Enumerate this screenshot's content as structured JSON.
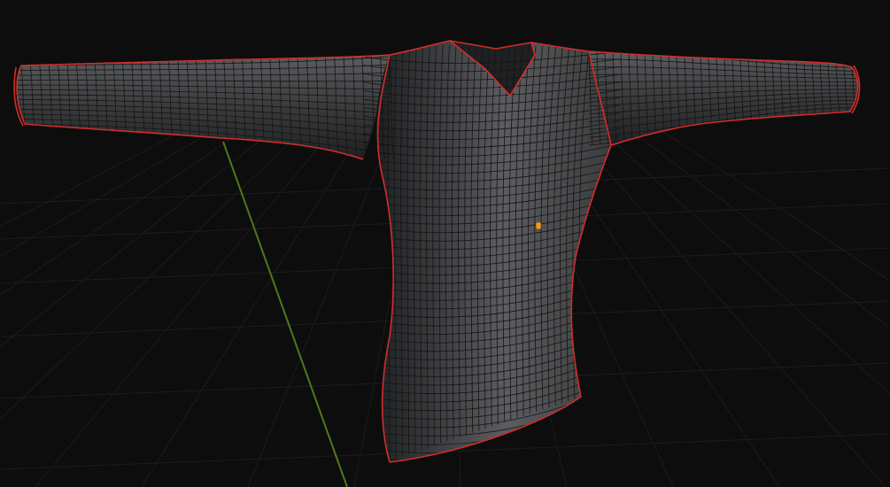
{
  "viewport": {
    "background": "#0d0d0d",
    "grid_color": "#1c1c1c",
    "y_axis_color": "#4d7a1a",
    "object_name": "shirt-mesh",
    "mesh_fill": "#3a3b3d",
    "mesh_highlight": "#5c5d60",
    "mesh_shadow": "#1f2022",
    "wire_color": "#141414",
    "seam_color": "#d22d2d",
    "origin_color": "#f39a1c",
    "shading_mode": "wireframe-overlay",
    "selection_state": "seams-highlighted"
  }
}
